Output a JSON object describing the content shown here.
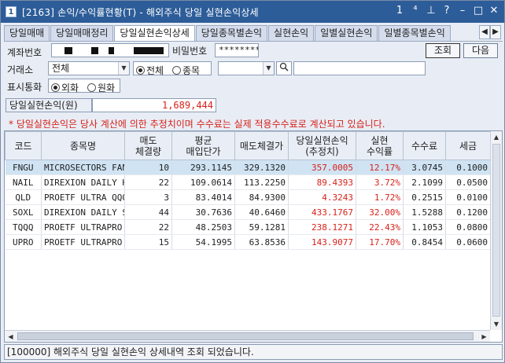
{
  "window": {
    "title": "[2163] 손익/수익률현황(T) - 해외주식 당일 실현손익상세",
    "icon_char": "1",
    "controls": [
      "1",
      "⁴",
      "⊥",
      "?",
      "–",
      "□",
      "✕"
    ]
  },
  "tabs": [
    {
      "label": "당일매매",
      "active": false
    },
    {
      "label": "당일매매정리",
      "active": false
    },
    {
      "label": "당일실현손익상세",
      "active": true
    },
    {
      "label": "당일종목별손익",
      "active": false
    },
    {
      "label": "실현손익",
      "active": false
    },
    {
      "label": "일별실현손익",
      "active": false
    },
    {
      "label": "일별종목별손익",
      "active": false
    }
  ],
  "tab_scroll": {
    "left": "◀",
    "right": "▶"
  },
  "form": {
    "account_label": "계좌번호",
    "password_label": "비밀번호",
    "password_value": "*********",
    "query_button": "조회",
    "next_button": "다음",
    "exchange_label": "거래소",
    "exchange_value": "전체",
    "scope_all": "전체",
    "scope_item": "종목",
    "currency_label": "표시통화",
    "currency_foreign": "외화",
    "currency_won": "원화",
    "pnl_label": "당일실현손익(원)",
    "pnl_value": "1,689,444",
    "note": "* 당일실현손익은 당사 계산에 의한 추정치이며 수수료는 실제 적용수수료로 계산되고 있습니다."
  },
  "table": {
    "headers": [
      "코드",
      "종목명",
      "매도\n체결량",
      "평균\n매입단가",
      "매도체결가",
      "당일실현손익\n(추정치)",
      "실현\n수익률",
      "수수료",
      "세금"
    ],
    "rows": [
      [
        "FNGU",
        "MICROSECTORS FAN",
        "10",
        "293.1145",
        "329.1320",
        "357.0005",
        "12.17%",
        "3.0745",
        "0.1000"
      ],
      [
        "NAIL",
        "DIREXION DAILY H",
        "22",
        "109.0614",
        "113.2250",
        "89.4393",
        "3.72%",
        "2.1099",
        "0.0500"
      ],
      [
        "QLD",
        "PROETF ULTRA QQQ",
        "3",
        "83.4014",
        "84.9300",
        "4.3243",
        "1.72%",
        "0.2515",
        "0.0100"
      ],
      [
        "SOXL",
        "DIREXION DAILY S",
        "44",
        "30.7636",
        "40.6460",
        "433.1767",
        "32.00%",
        "1.5288",
        "0.1200"
      ],
      [
        "TQQQ",
        "PROETF ULTRAPRO",
        "22",
        "48.2503",
        "59.1281",
        "238.1271",
        "22.43%",
        "1.1053",
        "0.0800"
      ],
      [
        "UPRO",
        "PROETF ULTRAPRO",
        "15",
        "54.1995",
        "63.8536",
        "143.9077",
        "17.70%",
        "0.8454",
        "0.0600"
      ]
    ],
    "selected_row": 0
  },
  "status": {
    "message": "[100000] 해외주식 당일 실현손익 상세내역 조회 되었습니다."
  },
  "colors": {
    "titlebar": "#2d5d99",
    "accent_red": "#d8211a",
    "selected_row": "#cfe3f3"
  }
}
